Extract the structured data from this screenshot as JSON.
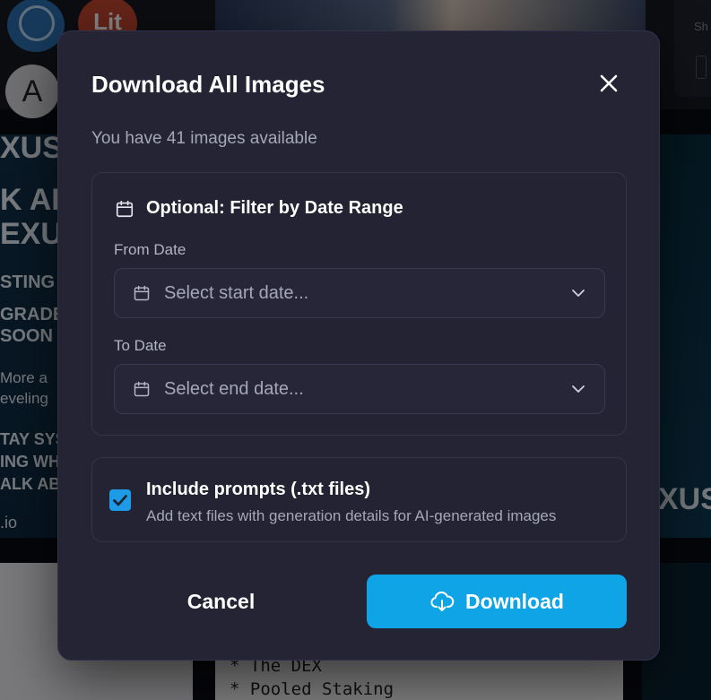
{
  "background": {
    "avatar_lit": "Lit",
    "avatar_a": "A",
    "rcard_text": "Sh",
    "banner_lines": [
      "XUS",
      "K AH",
      "EXU",
      "STING I",
      "GRADE",
      "SOON",
      "More a",
      "eveling",
      "TAY SYS",
      "ING WH",
      "ALK AB",
      ".io"
    ],
    "rbanner_text": "XUS",
    "doc_lines": [
      "* The DEX",
      "* Pooled Staking"
    ]
  },
  "modal": {
    "title": "Download All Images",
    "subtitle": "You have 41 images available",
    "filter": {
      "title": "Optional: Filter by Date Range",
      "from_label": "From Date",
      "from_placeholder": "Select start date...",
      "to_label": "To Date",
      "to_placeholder": "Select end date..."
    },
    "prompts": {
      "checked": true,
      "title": "Include prompts (.txt files)",
      "description": "Add text files with generation details for AI-generated images"
    },
    "cancel_label": "Cancel",
    "download_label": "Download"
  },
  "colors": {
    "accent": "#0fa4e6",
    "modal_bg": "#242435",
    "checkbox": "#1d9be6"
  },
  "icons": [
    "close-icon",
    "calendar-icon",
    "chevron-down-icon",
    "check-icon",
    "cloud-download-icon"
  ]
}
